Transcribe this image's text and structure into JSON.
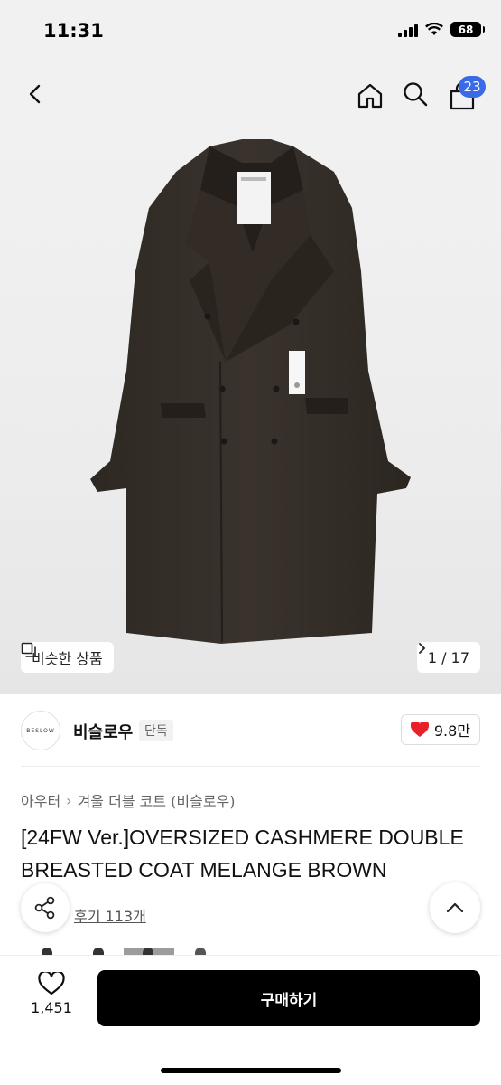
{
  "status": {
    "time": "11:31",
    "battery": "68"
  },
  "header": {
    "cart_badge": "23"
  },
  "gallery": {
    "similar_label": "비슷한 상품",
    "page_counter": "1 / 17",
    "current_page": 1,
    "total_pages": 17
  },
  "brand": {
    "logo_text": "BESLOW",
    "name": "비슬로우",
    "tag": "단독",
    "likes": "9.8만"
  },
  "product": {
    "category": "아우터",
    "subcategory": "겨울 더블 코트 (비슬로우)",
    "title": "[24FW Ver.]OVERSIZED CASHMERE DOUBLE BREASTED COAT MELANGE BROWN",
    "review_link": "후기 113개"
  },
  "bottom": {
    "wish_count": "1,451",
    "buy_label": "구매하기"
  },
  "colors": {
    "accent": "#3a6ae8",
    "like_heart": "#e8202a",
    "buy_button": "#000000"
  },
  "icons": [
    "back-icon",
    "home-icon",
    "search-icon",
    "cart-icon",
    "similar-icon",
    "chevron-right-icon",
    "heart-icon",
    "share-icon",
    "chevron-up-icon",
    "heart-outline-icon"
  ]
}
